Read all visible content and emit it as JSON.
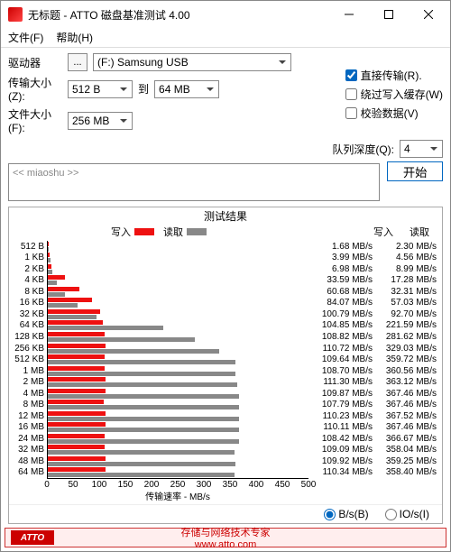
{
  "window": {
    "title": "无标题 - ATTO 磁盘基准测试 4.00"
  },
  "menu": {
    "file": "文件(F)",
    "help": "帮助(H)"
  },
  "form": {
    "drive_label": "驱动器",
    "drive_btn": "...",
    "drive_value": "(F:) Samsung USB",
    "xfer_label": "传输大小(Z):",
    "xfer_from": "512 B",
    "xfer_to_word": "到",
    "xfer_to": "64 MB",
    "file_label": "文件大小(F):",
    "file_value": "256 MB"
  },
  "options": {
    "direct": "直接传输(R).",
    "bypass": "绕过写入缓存(W)",
    "verify": "校验数据(V)",
    "qd_label": "队列深度(Q):",
    "qd_value": "4"
  },
  "desc": {
    "placeholder": "<< miaoshu >>"
  },
  "start": "开始",
  "results": {
    "title": "测试结果",
    "write": "写入",
    "read": "读取",
    "write_unit": "MB/s",
    "read_unit": "MB/s",
    "xlabel": "传输速率 - MB/s"
  },
  "radio": {
    "bs": "B/s(B)",
    "ios": "IO/s(I)"
  },
  "footer": {
    "badge": "ATTO",
    "text": "存储与网络技术专家",
    "url": "www.atto.com"
  },
  "chart_data": {
    "type": "bar",
    "xlabel": "传输速率 - MB/s",
    "xlim": [
      0,
      500
    ],
    "xticks": [
      0,
      50,
      100,
      150,
      200,
      250,
      300,
      350,
      400,
      450,
      500
    ],
    "categories": [
      "512 B",
      "1 KB",
      "2 KB",
      "4 KB",
      "8 KB",
      "16 KB",
      "32 KB",
      "64 KB",
      "128 KB",
      "256 KB",
      "512 KB",
      "1 MB",
      "2 MB",
      "4 MB",
      "8 MB",
      "12 MB",
      "16 MB",
      "24 MB",
      "32 MB",
      "48 MB",
      "64 MB"
    ],
    "series": [
      {
        "name": "写入",
        "color": "#e11",
        "unit": "MB/s",
        "values": [
          1.68,
          3.99,
          6.98,
          33.59,
          60.68,
          84.07,
          100.79,
          104.85,
          108.82,
          110.72,
          109.64,
          108.7,
          111.3,
          109.87,
          107.79,
          110.23,
          110.11,
          108.42,
          109.09,
          109.92,
          110.34
        ]
      },
      {
        "name": "读取",
        "color": "#888",
        "unit": "MB/s",
        "values": [
          2.3,
          4.56,
          8.99,
          17.28,
          32.31,
          57.03,
          92.7,
          221.59,
          281.62,
          329.03,
          359.72,
          360.56,
          363.12,
          367.46,
          367.46,
          367.52,
          367.46,
          366.67,
          358.04,
          359.25,
          358.4
        ]
      }
    ]
  }
}
